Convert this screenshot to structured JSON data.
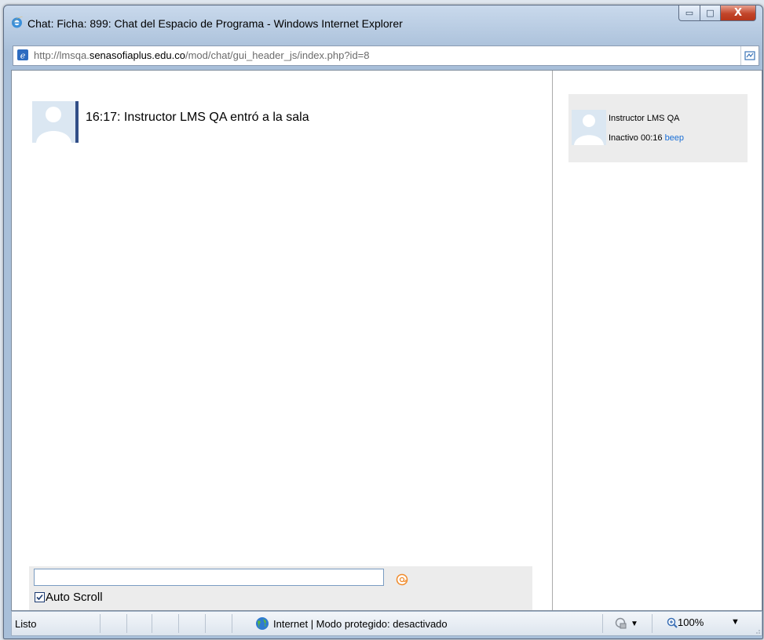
{
  "window": {
    "title": "Chat: Ficha: 899: Chat del Espacio de Programa - Windows Internet Explorer",
    "controls": {
      "minimize": "▭",
      "maximize": "□",
      "close": "X"
    }
  },
  "address": {
    "prefix": "http://lmsqa.",
    "domain": "senasofiaplus.edu.co",
    "path": "/mod/chat/gui_header_js/index.php?id=8"
  },
  "chat": {
    "messages": [
      {
        "text": "16:17: Instructor LMS QA entró a la sala"
      }
    ],
    "input": {
      "value": "",
      "placeholder": ""
    },
    "autoscroll": {
      "label": "Auto Scroll",
      "checked": true
    }
  },
  "users": [
    {
      "name": "Instructor LMS QA",
      "status": "Inactivo 00:16",
      "action": "beep"
    }
  ],
  "statusbar": {
    "status": "Listo",
    "zone": "Internet | Modo protegido: desactivado",
    "zoom": "100%"
  },
  "colors": {
    "link": "#1a6fd6",
    "avatar_border": "#314e87",
    "close_button": "#c2452a"
  },
  "icons": {
    "browser": "ie-logo-icon",
    "page": "page-icon",
    "compat": "compatibility-view-icon",
    "send": "send-icon",
    "zone": "globe-icon",
    "protected": "protected-mode-icon",
    "zoom": "zoom-icon"
  }
}
